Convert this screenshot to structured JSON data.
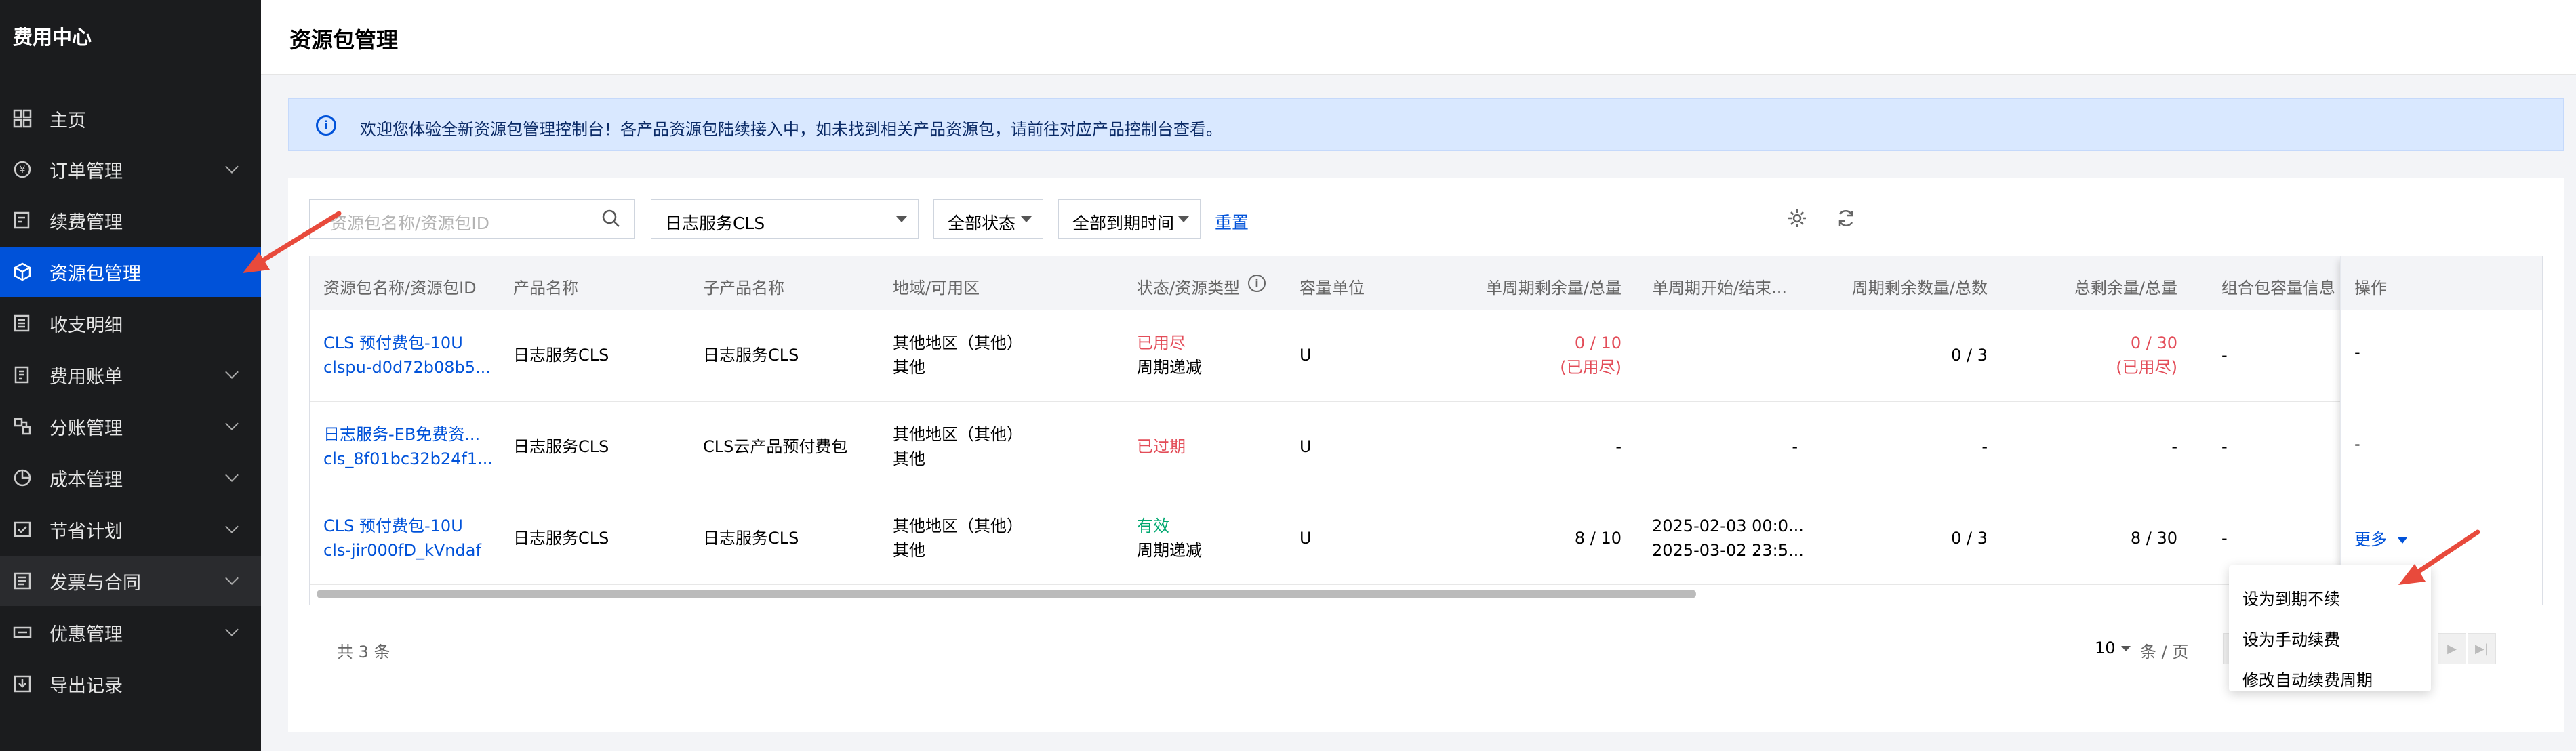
{
  "sidebar": {
    "title": "费用中心",
    "items": [
      {
        "label": "主页",
        "icon": "grid-icon",
        "chevron": false
      },
      {
        "label": "订单管理",
        "icon": "order-icon",
        "chevron": true
      },
      {
        "label": "续费管理",
        "icon": "renew-icon",
        "chevron": false
      },
      {
        "label": "资源包管理",
        "icon": "package-icon",
        "chevron": false,
        "active": true
      },
      {
        "label": "收支明细",
        "icon": "detail-icon",
        "chevron": false
      },
      {
        "label": "费用账单",
        "icon": "bill-icon",
        "chevron": true
      },
      {
        "label": "分账管理",
        "icon": "split-icon",
        "chevron": true
      },
      {
        "label": "成本管理",
        "icon": "pie-icon",
        "chevron": true
      },
      {
        "label": "节省计划",
        "icon": "plan-icon",
        "chevron": true
      },
      {
        "label": "发票与合同",
        "icon": "invoice-icon",
        "chevron": true
      },
      {
        "label": "优惠管理",
        "icon": "coupon-icon",
        "chevron": true
      },
      {
        "label": "导出记录",
        "icon": "export-icon",
        "chevron": false
      }
    ]
  },
  "header": {
    "title": "资源包管理"
  },
  "banner": {
    "text": "欢迎您体验全新资源包管理控制台！各产品资源包陆续接入中，如未找到相关产品资源包，请前往对应产品控制台查看。"
  },
  "filters": {
    "search_placeholder": "资源包名称/资源包ID",
    "product": "日志服务CLS",
    "status": "全部状态",
    "expiry": "全部到期时间",
    "reset": "重置"
  },
  "table": {
    "columns": [
      "资源包名称/资源包ID",
      "产品名称",
      "子产品名称",
      "地域/可用区",
      "状态/资源类型",
      "容量单位",
      "单周期剩余量/总量",
      "单周期开始/结束...",
      "周期剩余数量/总数",
      "总剩余量/总量",
      "组合包容量信息",
      "操作"
    ],
    "rows": [
      {
        "name": "CLS 预付费包-10U",
        "id": "clspu-d0d72b08b5...",
        "product": "日志服务CLS",
        "subproduct": "日志服务CLS",
        "region": "其他地区（其他）",
        "zone": "其他",
        "status": "已用尽",
        "status_color": "red",
        "resource_type": "周期递减",
        "unit": "U",
        "cycle_remain": "0 / 10",
        "cycle_remain_note": "(已用尽)",
        "cycle_start": "",
        "cycle_end": "",
        "cycle_count": "0 / 3",
        "total_remain": "0 / 30",
        "total_remain_note": "(已用尽)",
        "combo": "-",
        "action": "-"
      },
      {
        "name": "日志服务-EB免费资...",
        "id": "cls_8f01bc32b24f1...",
        "product": "日志服务CLS",
        "subproduct": "CLS云产品预付费包",
        "region": "其他地区（其他）",
        "zone": "其他",
        "status": "已过期",
        "status_color": "red",
        "resource_type": "",
        "unit": "U",
        "cycle_remain": "-",
        "cycle_remain_note": "",
        "cycle_start": "-",
        "cycle_end": "",
        "cycle_count": "-",
        "total_remain": "-",
        "total_remain_note": "",
        "combo": "-",
        "action": "-"
      },
      {
        "name": "CLS 预付费包-10U",
        "id": "cls-jir000fD_kVndaf",
        "product": "日志服务CLS",
        "subproduct": "日志服务CLS",
        "region": "其他地区（其他）",
        "zone": "其他",
        "status": "有效",
        "status_color": "green",
        "resource_type": "周期递减",
        "unit": "U",
        "cycle_remain": "8 / 10",
        "cycle_remain_note": "",
        "cycle_start": "2025-02-03 00:0...",
        "cycle_end": "2025-03-02 23:5...",
        "cycle_count": "0 / 3",
        "total_remain": "8 / 30",
        "total_remain_note": "",
        "combo": "-",
        "action": "更多"
      }
    ]
  },
  "pagination": {
    "total": "共 3 条",
    "page_size": "10",
    "page_unit": "条 / 页"
  },
  "dropdown": {
    "items": [
      "设为到期不续",
      "设为手动续费",
      "修改自动续费周期"
    ]
  },
  "colors": {
    "primary": "#0052d9",
    "sidebar_bg": "#1b1c1e",
    "danger": "#e34d59",
    "success": "#00a870",
    "annotation": "#e84a3c"
  }
}
